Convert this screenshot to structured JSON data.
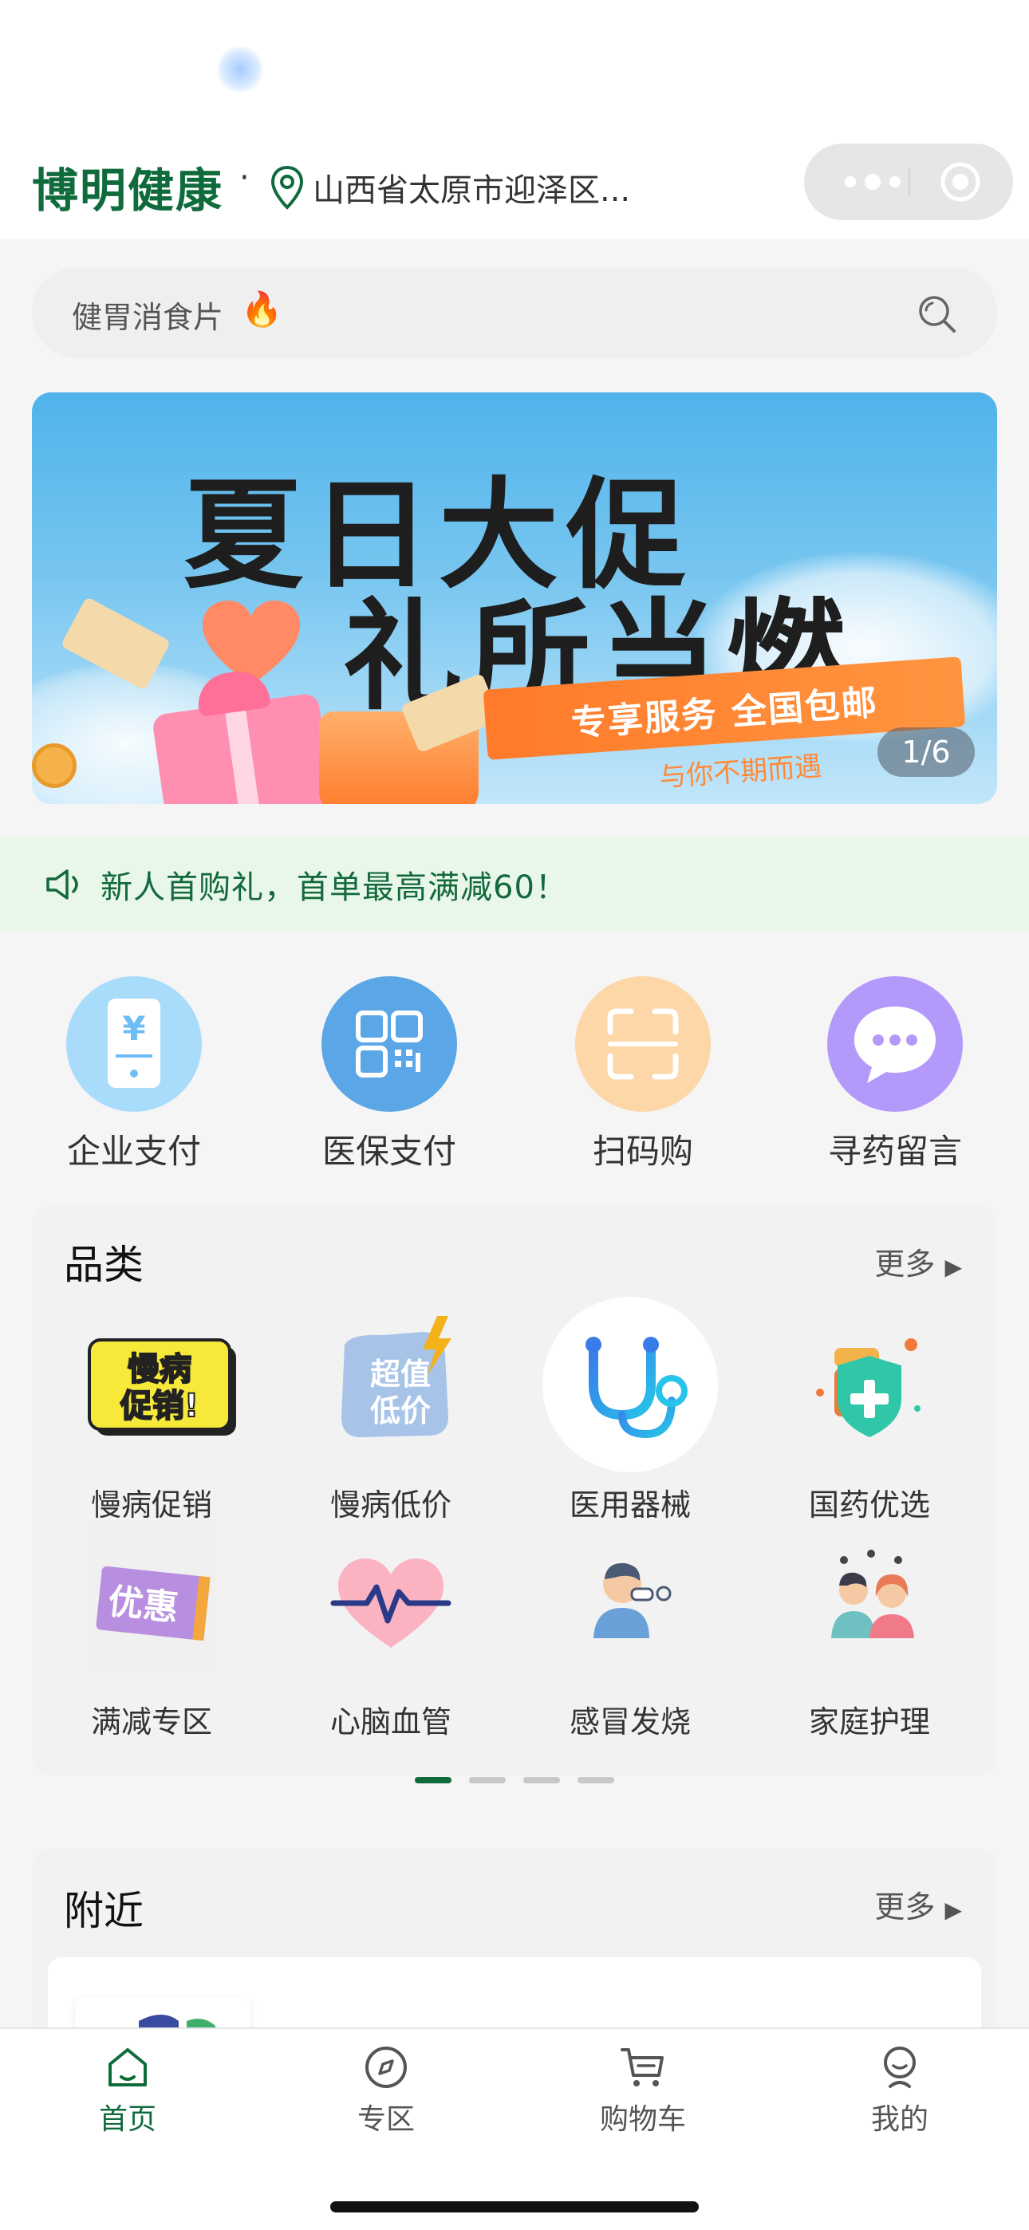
{
  "app": {
    "brand": "博明健康",
    "separator": "·",
    "location": "山西省太原市迎泽区..."
  },
  "search": {
    "placeholder": "健胃消食片",
    "hot_icon": "fire-icon"
  },
  "banner": {
    "title_line1": "夏日大促",
    "title_line2": "礼所当燃",
    "ribbon": "专享服务 全国包邮",
    "subtitle": "与你不期而遇",
    "page_indicator": "1/6"
  },
  "notice": {
    "text": "新人首购礼，首单最高满减60！"
  },
  "quick_actions": [
    {
      "label": "企业支付",
      "icon": "phone-yuan-icon",
      "color": "#a9dcfb"
    },
    {
      "label": "医保支付",
      "icon": "qr-code-icon",
      "color": "#5aa6e6"
    },
    {
      "label": "扫码购",
      "icon": "scan-icon",
      "color": "#fdd7a8"
    },
    {
      "label": "寻药留言",
      "icon": "chat-bubble-icon",
      "color": "#b39afa"
    }
  ],
  "categories": {
    "title": "品类",
    "more": "更多",
    "items": [
      {
        "label": "慢病促销",
        "badge_text": "慢病促销!"
      },
      {
        "label": "慢病低价",
        "badge_text": "超值低价"
      },
      {
        "label": "医用器械"
      },
      {
        "label": "国药优选"
      },
      {
        "label": "满减专区",
        "badge_text": "优惠"
      },
      {
        "label": "心脑血管"
      },
      {
        "label": "感冒发烧"
      },
      {
        "label": "家庭护理"
      }
    ],
    "pager_count": 4,
    "pager_active": 0
  },
  "nearby": {
    "title": "附近",
    "more": "更多"
  },
  "tabs": [
    {
      "label": "首页",
      "icon": "home-icon",
      "active": true
    },
    {
      "label": "专区",
      "icon": "compass-icon",
      "active": false
    },
    {
      "label": "购物车",
      "icon": "cart-icon",
      "active": false
    },
    {
      "label": "我的",
      "icon": "user-icon",
      "active": false
    }
  ],
  "colors": {
    "brand": "#0f6b3c",
    "active_tab": "#0f6b3c",
    "notice_bg": "#e8f7ea"
  }
}
